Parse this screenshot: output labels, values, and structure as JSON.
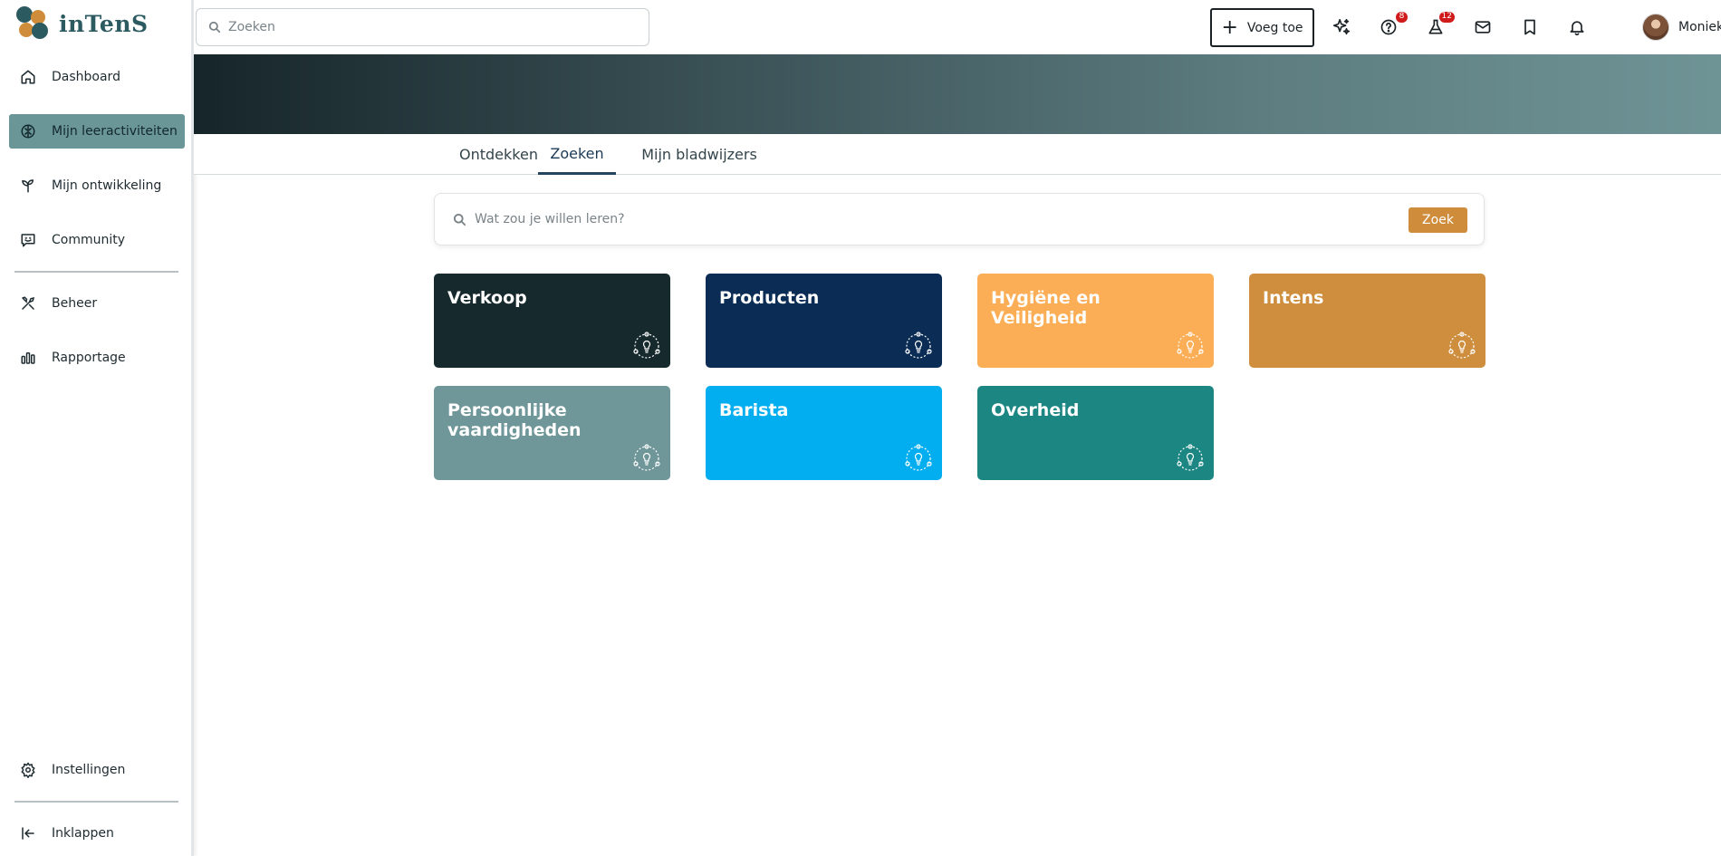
{
  "app": {
    "logo_text": "inTenS",
    "logo_colors": [
      "#2b5a60",
      "#cf8d3b"
    ]
  },
  "sidebar": {
    "items": [
      {
        "id": "dashboard",
        "label": "Dashboard",
        "icon": "home-icon",
        "active": false
      },
      {
        "id": "learning",
        "label": "Mijn leeractiviteiten",
        "icon": "brain-icon",
        "active": true
      },
      {
        "id": "development",
        "label": "Mijn ontwikkeling",
        "icon": "sprout-icon",
        "active": false
      },
      {
        "id": "community",
        "label": "Community",
        "icon": "chat-smile-icon",
        "active": false
      },
      {
        "id": "beheer",
        "label": "Beheer",
        "icon": "tools-icon",
        "active": false
      },
      {
        "id": "rapportage",
        "label": "Rapportage",
        "icon": "bar-chart-icon",
        "active": false
      }
    ],
    "settings_label": "Instellingen",
    "collapse_label": "Inklappen"
  },
  "topbar": {
    "search_placeholder": "Zoeken",
    "add_label": "Voeg toe",
    "help_badge": "8",
    "lab_badge": "12",
    "user_name": "Moniek"
  },
  "tabs": [
    {
      "label": "Ontdekken",
      "active": false
    },
    {
      "label": "Zoeken",
      "active": true
    },
    {
      "label": "Mijn bladwijzers",
      "active": false
    }
  ],
  "search": {
    "placeholder": "Wat zou je willen leren?",
    "button_label": "Zoek"
  },
  "tiles": [
    {
      "title": "Verkoop",
      "color": "#16292d"
    },
    {
      "title": "Producten",
      "color": "#0b2d55"
    },
    {
      "title": "Hygiëne en Veiligheid",
      "color": "#fbae55"
    },
    {
      "title": "Intens",
      "color": "#cf8e3e"
    },
    {
      "title": "Persoonlijke vaardigheden",
      "color": "#6f9698"
    },
    {
      "title": "Barista",
      "color": "#03aef0"
    },
    {
      "title": "Overheid",
      "color": "#1c8683"
    }
  ]
}
